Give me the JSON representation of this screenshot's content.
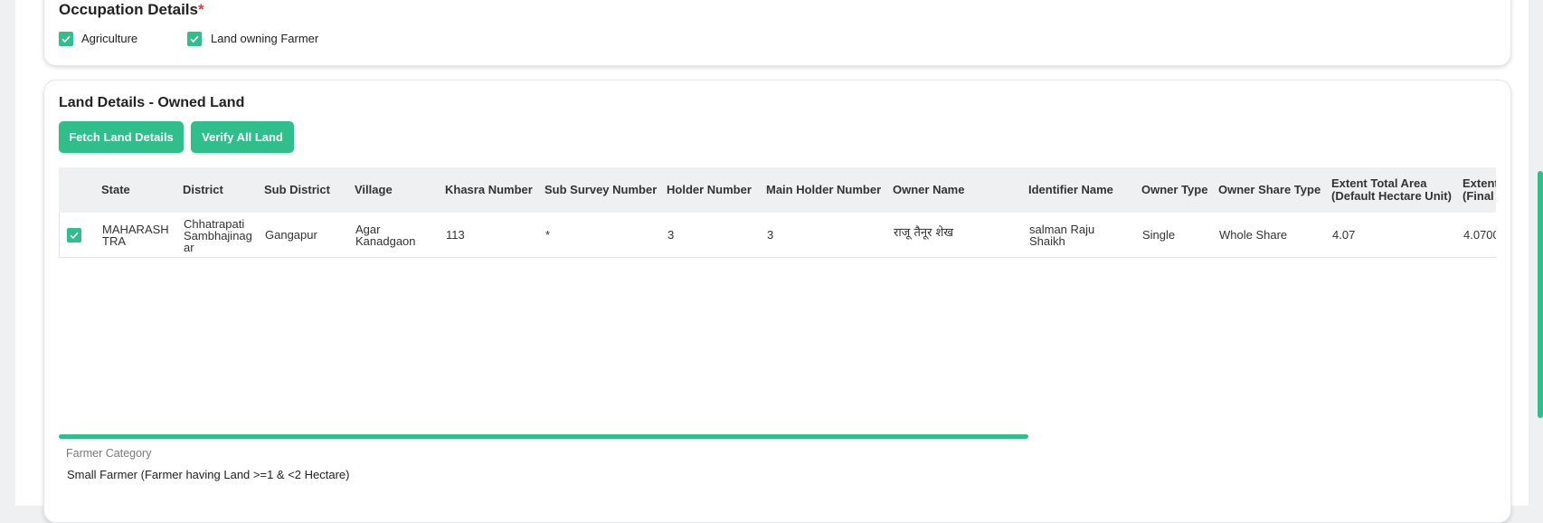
{
  "occupation": {
    "title": "Occupation Details",
    "required_mark": "*",
    "checkboxes": [
      {
        "label": "Agriculture",
        "checked": true
      },
      {
        "label": "Land owning Farmer",
        "checked": true
      }
    ]
  },
  "land": {
    "title": "Land Details - Owned Land",
    "fetch_button": "Fetch Land Details",
    "verify_button": "Verify All Land",
    "columns": [
      {
        "line1": "State",
        "line2": ""
      },
      {
        "line1": "District",
        "line2": ""
      },
      {
        "line1": "Sub District",
        "line2": ""
      },
      {
        "line1": "Village",
        "line2": ""
      },
      {
        "line1": "Khasra Number",
        "line2": ""
      },
      {
        "line1": "Sub Survey Number",
        "line2": ""
      },
      {
        "line1": "Holder Number",
        "line2": ""
      },
      {
        "line1": "Main Holder Number",
        "line2": ""
      },
      {
        "line1": "Owner Name",
        "line2": ""
      },
      {
        "line1": "Identifier Name",
        "line2": ""
      },
      {
        "line1": "Owner Type",
        "line2": ""
      },
      {
        "line1": "Owner Share Type",
        "line2": ""
      },
      {
        "line1": "Extent Total Area",
        "line2": "(Default Hectare Unit)"
      },
      {
        "line1": "Extent",
        "line2": "(Final"
      }
    ],
    "rows": [
      {
        "selected": true,
        "cells": [
          {
            "line1": "MAHARASH",
            "line2": "TRA",
            "line3": ""
          },
          {
            "line1": "Chhatrapati",
            "line2": "Sambhajinag",
            "line3": "ar"
          },
          {
            "line1": "Gangapur",
            "line2": "",
            "line3": ""
          },
          {
            "line1": "Agar",
            "line2": "Kanadgaon",
            "line3": ""
          },
          {
            "line1": "113",
            "line2": "",
            "line3": ""
          },
          {
            "line1": "*",
            "line2": "",
            "line3": ""
          },
          {
            "line1": "3",
            "line2": "",
            "line3": ""
          },
          {
            "line1": "3",
            "line2": "",
            "line3": ""
          },
          {
            "line1": "राजू तैनूर शेख",
            "line2": "",
            "line3": ""
          },
          {
            "line1": "salman Raju",
            "line2": "Shaikh",
            "line3": ""
          },
          {
            "line1": "Single",
            "line2": "",
            "line3": ""
          },
          {
            "line1": "Whole Share",
            "line2": "",
            "line3": ""
          },
          {
            "line1": "4.07",
            "line2": "",
            "line3": ""
          },
          {
            "line1": "4.0700",
            "line2": "",
            "line3": ""
          }
        ]
      }
    ],
    "horizontal_scroll_fraction": 0.675
  },
  "farmer_category": {
    "label": "Farmer Category",
    "value": "Small Farmer (Farmer having Land >=1 & <2 Hectare)"
  },
  "colors": {
    "accent": "#2fbe8c",
    "header_bg": "#eef0f1",
    "required": "#e53935"
  }
}
